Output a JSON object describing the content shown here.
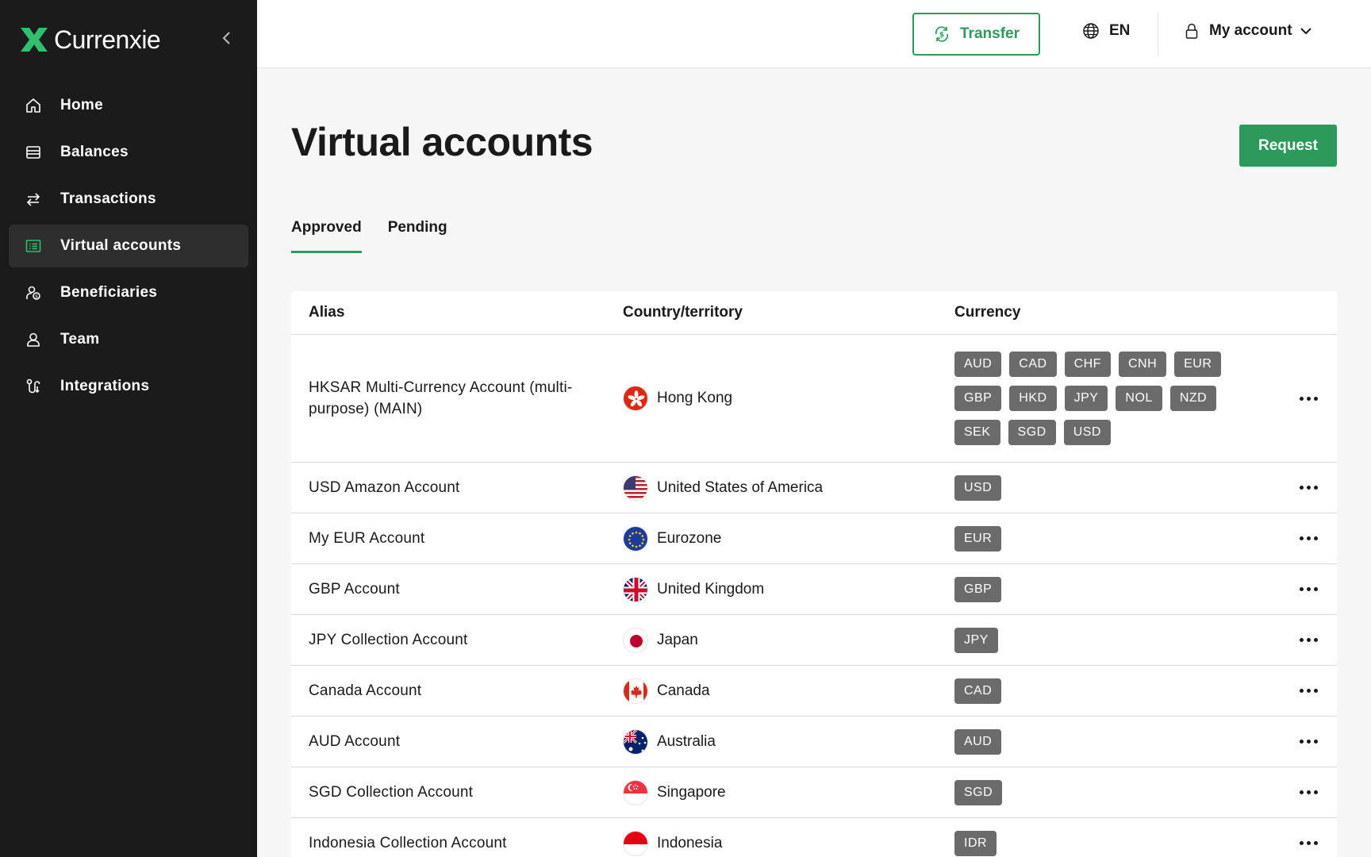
{
  "app": {
    "name": "Currenxie"
  },
  "sidebar": {
    "items": [
      {
        "label": "Home",
        "icon": "home-icon",
        "active": false
      },
      {
        "label": "Balances",
        "icon": "balances-icon",
        "active": false
      },
      {
        "label": "Transactions",
        "icon": "transfer-arrows-icon",
        "active": false
      },
      {
        "label": "Virtual accounts",
        "icon": "virtual-accounts-icon",
        "active": true
      },
      {
        "label": "Beneficiaries",
        "icon": "beneficiaries-icon",
        "active": false
      },
      {
        "label": "Team",
        "icon": "team-icon",
        "active": false
      },
      {
        "label": "Integrations",
        "icon": "integrations-icon",
        "active": false
      }
    ]
  },
  "topbar": {
    "transfer_label": "Transfer",
    "language": "EN",
    "account_label": "My account"
  },
  "page": {
    "title": "Virtual accounts",
    "request_label": "Request",
    "tabs": [
      {
        "label": "Approved",
        "active": true
      },
      {
        "label": "Pending",
        "active": false
      }
    ]
  },
  "table": {
    "headers": {
      "alias": "Alias",
      "country": "Country/territory",
      "currency": "Currency"
    },
    "rows": [
      {
        "alias": "HKSAR Multi-Currency Account (multi-purpose) (MAIN)",
        "country": "Hong Kong",
        "flag": "hk",
        "currencies": [
          "AUD",
          "CAD",
          "CHF",
          "CNH",
          "EUR",
          "GBP",
          "HKD",
          "JPY",
          "NOL",
          "NZD",
          "SEK",
          "SGD",
          "USD"
        ]
      },
      {
        "alias": "USD Amazon Account",
        "country": "United States of America",
        "flag": "us",
        "currencies": [
          "USD"
        ]
      },
      {
        "alias": "My EUR Account",
        "country": "Eurozone",
        "flag": "eu",
        "currencies": [
          "EUR"
        ]
      },
      {
        "alias": "GBP Account",
        "country": "United Kingdom",
        "flag": "gb",
        "currencies": [
          "GBP"
        ]
      },
      {
        "alias": "JPY Collection Account",
        "country": "Japan",
        "flag": "jp",
        "currencies": [
          "JPY"
        ]
      },
      {
        "alias": "Canada Account",
        "country": "Canada",
        "flag": "ca",
        "currencies": [
          "CAD"
        ]
      },
      {
        "alias": "AUD Account",
        "country": "Australia",
        "flag": "au",
        "currencies": [
          "AUD"
        ]
      },
      {
        "alias": "SGD Collection Account",
        "country": "Singapore",
        "flag": "sg",
        "currencies": [
          "SGD"
        ]
      },
      {
        "alias": "Indonesia Collection Account",
        "country": "Indonesia",
        "flag": "id",
        "currencies": [
          "IDR"
        ]
      }
    ]
  },
  "colors": {
    "brand_green": "#2b9a5a",
    "sidebar_bg": "#1b1b1b",
    "sidebar_active_bg": "#2e2e2e",
    "chip_bg": "#6b6b6b"
  }
}
